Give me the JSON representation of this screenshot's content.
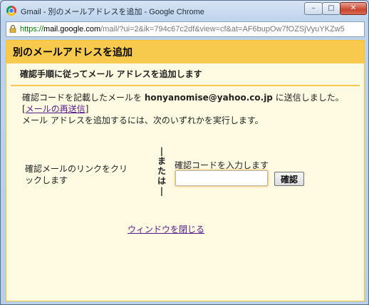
{
  "window": {
    "title": "Gmail - 別のメールアドレスを追加 - Google Chrome",
    "controls": {
      "minimize": "–",
      "maximize": "□",
      "close": "✕"
    }
  },
  "address_bar": {
    "scheme": "https://",
    "host": "mail.google.com",
    "path": "/mail/?ui=2&ik=794c67c2df&view=cf&at=AF6bupOw7fOZSjVyuYKZw5"
  },
  "dialog": {
    "title": "別のメールアドレスを追加",
    "subheader": "確認手順に従ってメール アドレスを追加します",
    "message": {
      "before_email": "確認コードを記載したメールを ",
      "email": "honyanomise@yahoo.co.jp",
      "after_email": " に送信しました。 [",
      "resend_link": "メールの再送信",
      "bracket_close": "]",
      "line2": "メール アドレスを追加するには、次のいずれかを実行します。"
    },
    "option_left": "確認メールのリンクをクリックします",
    "or_separator": [
      "|",
      "ま",
      "た",
      "は",
      "|"
    ],
    "option_right_label": "確認コードを入力します",
    "code_input_value": "",
    "confirm_button": "確認",
    "close_link": "ウィンドウを閉じる"
  }
}
